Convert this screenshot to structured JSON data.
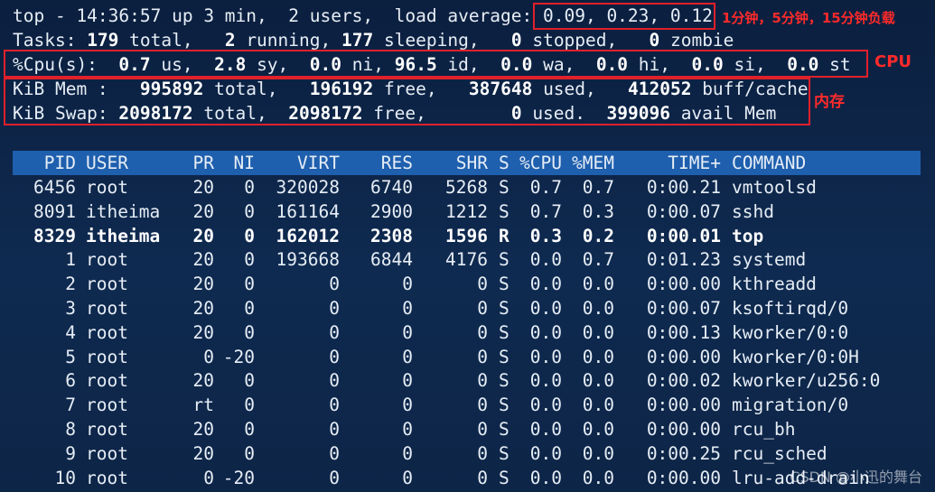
{
  "summary": {
    "line1": {
      "prefix": "top - 14:36:57 up 3 min,  2 users,  load average: ",
      "load": "0.09, 0.23, 0.12"
    },
    "line2": {
      "a": "Tasks: ",
      "total": "179",
      "b": " total,   ",
      "running": "2",
      "c": " running, ",
      "sleeping": "177",
      "d": " sleeping,   ",
      "stopped": "0",
      "e": " stopped,   ",
      "zombie": "0",
      "f": " zombie"
    },
    "line3": {
      "a": "%Cpu(s):  ",
      "us": "0.7",
      "b": " us,  ",
      "sy": "2.8",
      "c": " sy,  ",
      "ni": "0.0",
      "d": " ni, ",
      "id": "96.5",
      "e": " id,  ",
      "wa": "0.0",
      "f": " wa,  ",
      "hi": "0.0",
      "g": " hi,  ",
      "si": "0.0",
      "h": " si,  ",
      "st": "0.0",
      "i": " st"
    },
    "line4": {
      "a": "KiB Mem :   ",
      "total": "995892",
      "b": " total,   ",
      "free": "196192",
      "c": " free,   ",
      "used": "387648",
      "d": " used,   ",
      "buff": "412052",
      "e": " buff/cache"
    },
    "line5": {
      "a": "KiB Swap: ",
      "total": "2098172",
      "b": " total,  ",
      "free": "2098172",
      "c": " free,        ",
      "used": "0",
      "d": " used.  ",
      "avail": "399096",
      "e": " avail Mem"
    }
  },
  "annotations": {
    "load": "1分钟，5分钟，15分钟负载",
    "cpu": "CPU",
    "mem": "内存"
  },
  "columns": [
    "PID",
    "USER",
    "PR",
    "NI",
    "VIRT",
    "RES",
    "SHR",
    "S",
    "%CPU",
    "%MEM",
    "TIME+",
    "COMMAND"
  ],
  "processes": [
    {
      "pid": "6456",
      "user": "root",
      "pr": "20",
      "ni": "0",
      "virt": "320028",
      "res": "6740",
      "shr": "5268",
      "s": "S",
      "cpu": "0.7",
      "mem": "0.7",
      "time": "0:00.21",
      "cmd": "vmtoolsd",
      "bold": false
    },
    {
      "pid": "8091",
      "user": "itheima",
      "pr": "20",
      "ni": "0",
      "virt": "161164",
      "res": "2900",
      "shr": "1212",
      "s": "S",
      "cpu": "0.7",
      "mem": "0.3",
      "time": "0:00.07",
      "cmd": "sshd",
      "bold": false
    },
    {
      "pid": "8329",
      "user": "itheima",
      "pr": "20",
      "ni": "0",
      "virt": "162012",
      "res": "2308",
      "shr": "1596",
      "s": "R",
      "cpu": "0.3",
      "mem": "0.2",
      "time": "0:00.01",
      "cmd": "top",
      "bold": true
    },
    {
      "pid": "1",
      "user": "root",
      "pr": "20",
      "ni": "0",
      "virt": "193668",
      "res": "6844",
      "shr": "4176",
      "s": "S",
      "cpu": "0.0",
      "mem": "0.7",
      "time": "0:01.23",
      "cmd": "systemd",
      "bold": false
    },
    {
      "pid": "2",
      "user": "root",
      "pr": "20",
      "ni": "0",
      "virt": "0",
      "res": "0",
      "shr": "0",
      "s": "S",
      "cpu": "0.0",
      "mem": "0.0",
      "time": "0:00.00",
      "cmd": "kthreadd",
      "bold": false
    },
    {
      "pid": "3",
      "user": "root",
      "pr": "20",
      "ni": "0",
      "virt": "0",
      "res": "0",
      "shr": "0",
      "s": "S",
      "cpu": "0.0",
      "mem": "0.0",
      "time": "0:00.07",
      "cmd": "ksoftirqd/0",
      "bold": false
    },
    {
      "pid": "4",
      "user": "root",
      "pr": "20",
      "ni": "0",
      "virt": "0",
      "res": "0",
      "shr": "0",
      "s": "S",
      "cpu": "0.0",
      "mem": "0.0",
      "time": "0:00.13",
      "cmd": "kworker/0:0",
      "bold": false
    },
    {
      "pid": "5",
      "user": "root",
      "pr": "0",
      "ni": "-20",
      "virt": "0",
      "res": "0",
      "shr": "0",
      "s": "S",
      "cpu": "0.0",
      "mem": "0.0",
      "time": "0:00.00",
      "cmd": "kworker/0:0H",
      "bold": false
    },
    {
      "pid": "6",
      "user": "root",
      "pr": "20",
      "ni": "0",
      "virt": "0",
      "res": "0",
      "shr": "0",
      "s": "S",
      "cpu": "0.0",
      "mem": "0.0",
      "time": "0:00.02",
      "cmd": "kworker/u256:0",
      "bold": false
    },
    {
      "pid": "7",
      "user": "root",
      "pr": "rt",
      "ni": "0",
      "virt": "0",
      "res": "0",
      "shr": "0",
      "s": "S",
      "cpu": "0.0",
      "mem": "0.0",
      "time": "0:00.00",
      "cmd": "migration/0",
      "bold": false
    },
    {
      "pid": "8",
      "user": "root",
      "pr": "20",
      "ni": "0",
      "virt": "0",
      "res": "0",
      "shr": "0",
      "s": "S",
      "cpu": "0.0",
      "mem": "0.0",
      "time": "0:00.00",
      "cmd": "rcu_bh",
      "bold": false
    },
    {
      "pid": "9",
      "user": "root",
      "pr": "20",
      "ni": "0",
      "virt": "0",
      "res": "0",
      "shr": "0",
      "s": "S",
      "cpu": "0.0",
      "mem": "0.0",
      "time": "0:00.25",
      "cmd": "rcu_sched",
      "bold": false
    },
    {
      "pid": "10",
      "user": "root",
      "pr": "0",
      "ni": "-20",
      "virt": "0",
      "res": "0",
      "shr": "0",
      "s": "S",
      "cpu": "0.0",
      "mem": "0.0",
      "time": "0:00.00",
      "cmd": "lru-add-drain",
      "bold": false
    }
  ],
  "watermark": "CSDN @小迅的舞台"
}
